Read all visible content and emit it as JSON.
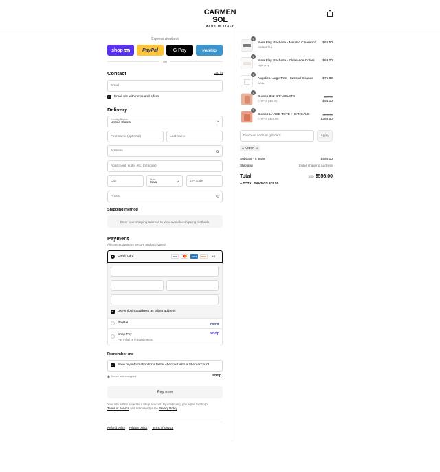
{
  "brand": {
    "name": "CARMEN SOL",
    "tagline": "MADE IN ITALY"
  },
  "express": {
    "title": "Express checkout",
    "buttons": [
      {
        "label": "shop",
        "sub": "Pay",
        "bg": "#5a31f4"
      },
      {
        "label": "PayPal",
        "bg": "#ffc439"
      },
      {
        "label": "G Pay",
        "bg": "#000000"
      },
      {
        "label": "venmo",
        "bg": "#3d95ce"
      }
    ],
    "or": "OR"
  },
  "contact": {
    "title": "Contact",
    "login": "Log in",
    "email_placeholder": "Email",
    "news_label": "Email me with news and offers"
  },
  "delivery": {
    "title": "Delivery",
    "country_label": "Country/Region",
    "country_value": "United States",
    "first_name": "First name (optional)",
    "last_name": "Last name",
    "address": "Address",
    "apartment": "Apartment, suite, etc. (optional)",
    "city": "City",
    "state_label": "State",
    "state_value": "Iowa",
    "zip": "ZIP code",
    "phone": "Phone"
  },
  "shipping_method": {
    "title": "Shipping method",
    "note": "Enter your shipping address to view available shipping methods."
  },
  "payment": {
    "title": "Payment",
    "subtitle": "All transactions are secure and encrypted.",
    "credit_card": "Credit card",
    "cards": [
      "VISA",
      "MC",
      "AMEX",
      "DISC"
    ],
    "more_cards": "+4",
    "billing_same": "Use shipping address as billing address",
    "paypal": "PayPal",
    "paypal_logo": "PayPal",
    "shop_pay": "Shop Pay",
    "shop_pay_sub": "Pay in full or in installments",
    "shop_logo": "shop"
  },
  "remember": {
    "title": "Remember me",
    "save_label": "Save my information for a faster checkout with a Shop account",
    "secure": "Secure and encrypted",
    "shop_logo": "shop"
  },
  "pay_now": "Pay now",
  "legal": {
    "line1": "Your info will be saved to a Shop account. By continuing, you agree to Shop's",
    "terms": "Terms of Service",
    "and_ack": "and acknowledge the",
    "privacy": "Privacy Policy"
  },
  "footer": [
    "Refund policy",
    "Privacy policy",
    "Terms of service"
  ],
  "cart": {
    "items": [
      {
        "qty": "1",
        "name": "Nora Flap Pochette - Metallic Clearance",
        "variant": "GUNMETAL",
        "price": "$62.50",
        "orig": ""
      },
      {
        "qty": "1",
        "name": "Nora Flap Pochette - Clearance Colors",
        "variant": "Light grey",
        "price": "$63.00",
        "orig": ""
      },
      {
        "qty": "1",
        "name": "Angelica Large Tote - Second Chance",
        "variant": "White",
        "price": "$71.00",
        "orig": ""
      },
      {
        "qty": "1",
        "name": "Combo 3x2 BRACELETS",
        "variant": "VIP10 (-$6.00)",
        "price": "$54.00",
        "orig": "$60.00"
      },
      {
        "qty": "1",
        "name": "Combo LARGE TOTE + SANDALS",
        "variant": "VIP10 (-$29.50)",
        "price": "$265.50",
        "orig": "$295.00"
      }
    ],
    "discount_placeholder": "Discount code or gift card",
    "apply": "Apply",
    "code": "VIP10",
    "subtotal_label": "Subtotal · 5 items",
    "subtotal": "$556.00",
    "shipping_label": "Shipping",
    "shipping_value": "Enter shipping address",
    "total_label": "Total",
    "currency": "USD",
    "total": "$556.00",
    "savings_label": "TOTAL SAVINGS",
    "savings": "$35.50"
  }
}
